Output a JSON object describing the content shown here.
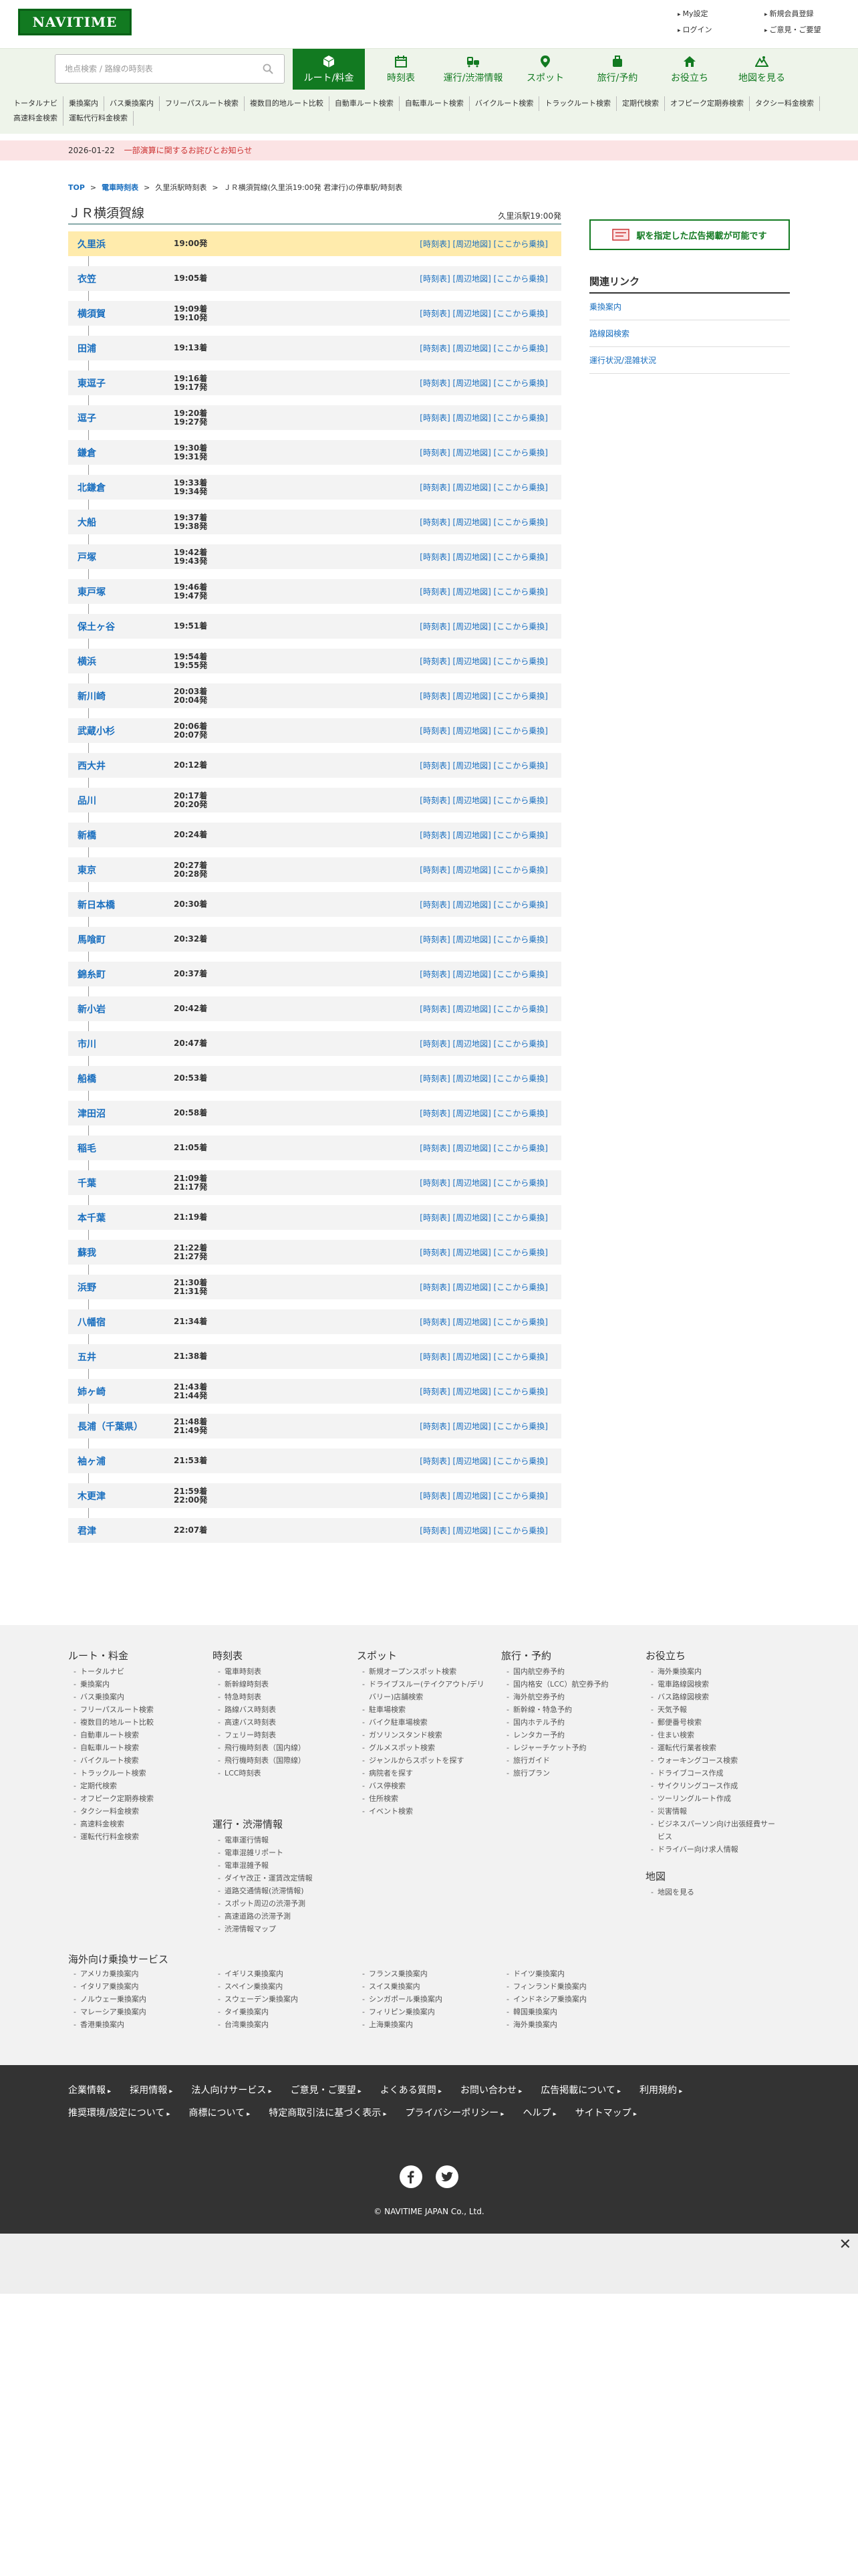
{
  "header": {
    "logo": "NAVITIME",
    "links": [
      "My設定",
      "新規会員登録",
      "ログイン",
      "ご意見・ご要望"
    ]
  },
  "search": {
    "placeholder": "地点検索 / 路線の時刻表"
  },
  "tabs": [
    "ルート/料金",
    "時刻表",
    "運行/渋滞情報",
    "スポット",
    "旅行/予約",
    "お役立ち",
    "地図を見る"
  ],
  "subnav": [
    "トータルナビ",
    "乗換案内",
    "バス乗換案内",
    "フリーパスルート検索",
    "複数目的地ルート比較",
    "自動車ルート検索",
    "自転車ルート検索",
    "バイクルート検索",
    "トラックルート検索",
    "定期代検索",
    "オフピーク定期券検索",
    "タクシー料金検索",
    "高速料金検索",
    "運転代行料金検索"
  ],
  "notice": {
    "date": "2026-01-22",
    "text": "一部演算に関するお詫びとお知らせ"
  },
  "breadcrumb": {
    "top": "TOP",
    "timetable": "電車時刻表",
    "station": "久里浜駅時刻表",
    "current": "ＪＲ横須賀線(久里浜19:00発 君津行)の停車駅/時刻表"
  },
  "line": {
    "title": "ＪＲ横須賀線",
    "departure": "久里浜駅19:00発"
  },
  "stop_links": "[時刻表] [周辺地図] [ここから乗換]",
  "stops": [
    {
      "name": "久里浜",
      "time": "19:00発"
    },
    {
      "name": "衣笠",
      "time": "19:05着"
    },
    {
      "name": "横須賀",
      "time": "19:09着\n19:10発"
    },
    {
      "name": "田浦",
      "time": "19:13着"
    },
    {
      "name": "東逗子",
      "time": "19:16着\n19:17発"
    },
    {
      "name": "逗子",
      "time": "19:20着\n19:27発"
    },
    {
      "name": "鎌倉",
      "time": "19:30着\n19:31発"
    },
    {
      "name": "北鎌倉",
      "time": "19:33着\n19:34発"
    },
    {
      "name": "大船",
      "time": "19:37着\n19:38発"
    },
    {
      "name": "戸塚",
      "time": "19:42着\n19:43発"
    },
    {
      "name": "東戸塚",
      "time": "19:46着\n19:47発"
    },
    {
      "name": "保土ヶ谷",
      "time": "19:51着"
    },
    {
      "name": "横浜",
      "time": "19:54着\n19:55発"
    },
    {
      "name": "新川崎",
      "time": "20:03着\n20:04発"
    },
    {
      "name": "武蔵小杉",
      "time": "20:06着\n20:07発"
    },
    {
      "name": "西大井",
      "time": "20:12着"
    },
    {
      "name": "品川",
      "time": "20:17着\n20:20発"
    },
    {
      "name": "新橋",
      "time": "20:24着"
    },
    {
      "name": "東京",
      "time": "20:27着\n20:28発"
    },
    {
      "name": "新日本橋",
      "time": "20:30着"
    },
    {
      "name": "馬喰町",
      "time": "20:32着"
    },
    {
      "name": "錦糸町",
      "time": "20:37着"
    },
    {
      "name": "新小岩",
      "time": "20:42着"
    },
    {
      "name": "市川",
      "time": "20:47着"
    },
    {
      "name": "船橋",
      "time": "20:53着"
    },
    {
      "name": "津田沼",
      "time": "20:58着"
    },
    {
      "name": "稲毛",
      "time": "21:05着"
    },
    {
      "name": "千葉",
      "time": "21:09着\n21:17発"
    },
    {
      "name": "本千葉",
      "time": "21:19着"
    },
    {
      "name": "蘇我",
      "time": "21:22着\n21:27発"
    },
    {
      "name": "浜野",
      "time": "21:30着\n21:31発"
    },
    {
      "name": "八幡宿",
      "time": "21:34着"
    },
    {
      "name": "五井",
      "time": "21:38着"
    },
    {
      "name": "姉ヶ崎",
      "time": "21:43着\n21:44発"
    },
    {
      "name": "長浦（千葉県）",
      "time": "21:48着\n21:49発"
    },
    {
      "name": "袖ヶ浦",
      "time": "21:53着"
    },
    {
      "name": "木更津",
      "time": "21:59着\n22:00発"
    },
    {
      "name": "君津",
      "time": "22:07着"
    }
  ],
  "sidebar": {
    "ad": "駅を指定した広告掲載が可能です",
    "related_title": "関連リンク",
    "related": [
      "乗換案内",
      "路線図検索",
      "運行状況/混雑状況"
    ]
  },
  "footer": {
    "columns": [
      {
        "title": "ルート・料金",
        "items": [
          "トータルナビ",
          "乗換案内",
          "バス乗換案内",
          "フリーパスルート検索",
          "複数目的地ルート比較",
          "自動車ルート検索",
          "自転車ルート検索",
          "バイクルート検索",
          "トラックルート検索",
          "定期代検索",
          "オフピーク定期券検索",
          "タクシー料金検索",
          "高速料金検索",
          "運転代行料金検索"
        ]
      },
      {
        "title": "時刻表",
        "items": [
          "電車時刻表",
          "新幹線時刻表",
          "特急時刻表",
          "路線バス時刻表",
          "高速バス時刻表",
          "フェリー時刻表",
          "飛行機時刻表（国内線）",
          "飛行機時刻表（国際線）",
          "LCC時刻表"
        ]
      },
      {
        "title": "運行・渋滞情報",
        "items": [
          "電車運行情報",
          "電車混雑リポート",
          "電車混雑予報",
          "ダイヤ改正・運賃改定情報",
          "道路交通情報(渋滞情報)",
          "スポット周辺の渋滞予測",
          "高速道路の渋滞予測",
          "渋滞情報マップ"
        ]
      },
      {
        "title": "スポット",
        "items": [
          "新規オープンスポット検索",
          "ドライブスルー(テイクアウト/デリバリー)店舗検索",
          "駐車場検索",
          "バイク駐車場検索",
          "ガソリンスタンド検索",
          "グルメスポット検索",
          "ジャンルからスポットを探す",
          "病院者を探す",
          "バス停検索",
          "住所検索",
          "イベント検索"
        ]
      },
      {
        "title": "旅行・予約",
        "items": [
          "国内航空券予約",
          "国内格安（LCC）航空券予約",
          "海外航空券予約",
          "新幹線・特急予約",
          "国内ホテル予約",
          "レンタカー予約",
          "レジャーチケット予約",
          "旅行ガイド",
          "旅行プラン"
        ]
      },
      {
        "title": "お役立ち",
        "items": [
          "海外乗換案内",
          "電車路線図検索",
          "バス路線図検索",
          "天気予報",
          "郵便番号検索",
          "住まい検索",
          "運転代行業者検索",
          "ウォーキングコース検索",
          "ドライブコース作成",
          "サイクリングコース作成",
          "ツーリングルート作成",
          "災害情報",
          "ビジネスパーソン向け出張経費サービス",
          "ドライバー向け求人情報"
        ]
      },
      {
        "title": "地図",
        "items": [
          "地図を見る"
        ]
      }
    ],
    "intl_title": "海外向け乗換サービス",
    "intl": [
      "アメリカ乗換案内",
      "イギリス乗換案内",
      "フランス乗換案内",
      "ドイツ乗換案内",
      "イタリア乗換案内",
      "スペイン乗換案内",
      "スイス乗換案内",
      "フィンランド乗換案内",
      "ノルウェー乗換案内",
      "スウェーデン乗換案内",
      "シンガポール乗換案内",
      "インドネシア乗換案内",
      "マレーシア乗換案内",
      "タイ乗換案内",
      "フィリピン乗換案内",
      "韓国乗換案内",
      "香港乗換案内",
      "台湾乗換案内",
      "上海乗換案内",
      "海外乗換案内"
    ]
  },
  "bottom": {
    "links": [
      "企業情報",
      "採用情報",
      "法人向けサービス",
      "ご意見・ご要望",
      "よくある質問",
      "お問い合わせ",
      "広告掲載について",
      "利用規約",
      "推奨環境/設定について",
      "商標について",
      "特定商取引法に基づく表示",
      "プライバシーポリシー",
      "ヘルプ",
      "サイトマップ"
    ],
    "copyright": "© NAVITIME JAPAN Co., Ltd."
  },
  "colors": {
    "brand": "#127a21",
    "link": "#1a6fbf",
    "highlight": "#ffebac"
  }
}
